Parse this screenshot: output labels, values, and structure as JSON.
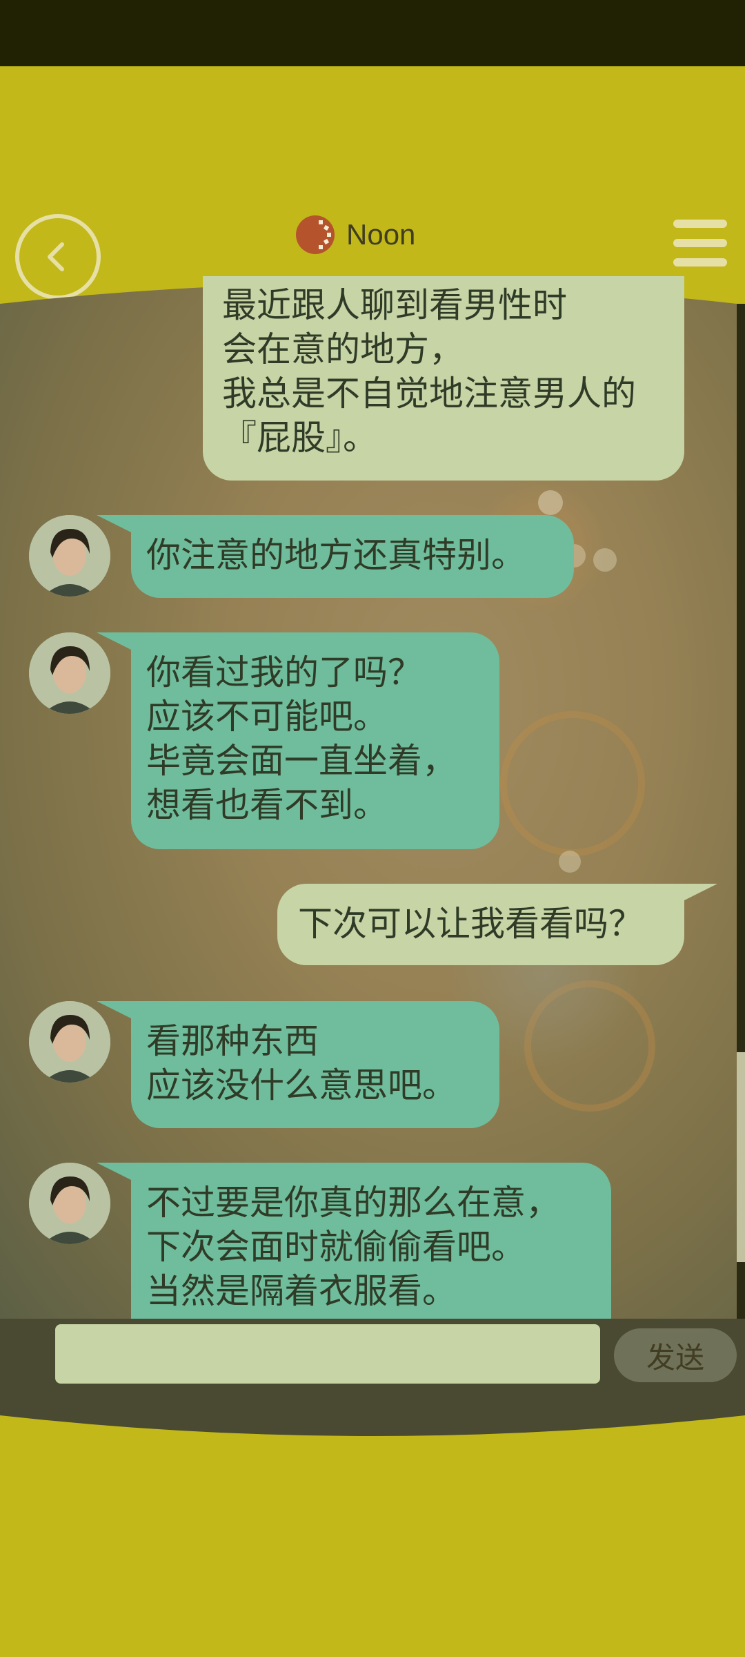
{
  "header": {
    "title": "Noon",
    "back_icon": "chevron-left-icon",
    "menu_icon": "hamburger-menu-icon",
    "title_icon": "sun-gear-icon"
  },
  "messages": [
    {
      "sender": "me",
      "text": "最近跟人聊到看男性时\n会在意的地方，\n我总是不自觉地注意男人的\n『屁股』。"
    },
    {
      "sender": "bot",
      "text": "你注意的地方还真特别。"
    },
    {
      "sender": "bot",
      "text": "你看过我的了吗？\n应该不可能吧。\n毕竟会面一直坐着，\n想看也看不到。"
    },
    {
      "sender": "me",
      "text": "下次可以让我看看吗？"
    },
    {
      "sender": "bot",
      "text": "看那种东西\n应该没什么意思吧。"
    },
    {
      "sender": "bot",
      "text": "不过要是你真的那么在意，\n下次会面时就偷偷看吧。\n当然是隔着衣服看。"
    }
  ],
  "composer": {
    "input_value": "",
    "input_placeholder": "",
    "send_label": "发送"
  },
  "colors": {
    "accent": "#c2b81a",
    "bot_bubble": "#6fbd9c",
    "user_bubble": "#c7d4a6",
    "status_bar": "#212203"
  }
}
